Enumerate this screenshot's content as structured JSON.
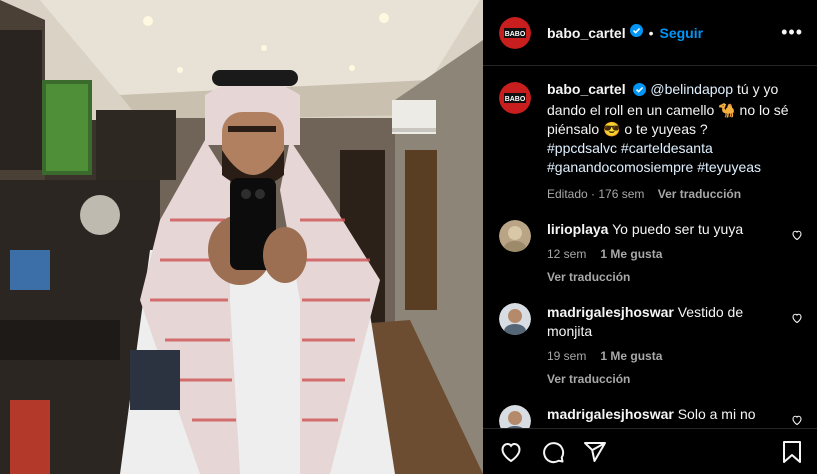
{
  "header": {
    "username": "babo_cartel",
    "separator": "•",
    "follow_label": "Seguir",
    "more_label": "•••"
  },
  "caption": {
    "username": "babo_cartel",
    "mention": "@belindapop",
    "text_1": " tú y yo dando el roll en un camello ",
    "emoji_1": "🐪",
    "text_2": " no lo sé piénsalo ",
    "emoji_2": "😎",
    "text_3": " o te yuyeas ?",
    "hashtags": "#ppcdsalvc #carteldesanta #ganandocomosiempre #teyuyeas",
    "edited": "Editado · 176 sem",
    "translate": "Ver traducción"
  },
  "comments": [
    {
      "username": "lirioplaya",
      "text": "Yo puedo ser tu yuya",
      "time": "12 sem",
      "likes": "1 Me gusta",
      "translate": "Ver traducción"
    },
    {
      "username": "madrigalesjhoswar",
      "text": "Vestido de monjita",
      "time": "19 sem",
      "likes": "1 Me gusta",
      "translate": "Ver traducción"
    },
    {
      "username": "madrigalesjhoswar",
      "text": "Solo a mi no"
    }
  ],
  "icons": {
    "like": "heart-icon",
    "comment": "comment-icon",
    "share": "share-icon",
    "save": "bookmark-icon",
    "verified": "verified-badge-icon"
  },
  "colors": {
    "accent": "#0095f6",
    "verified": "#0095f6",
    "background": "#000000",
    "muted": "#a8a8a8"
  }
}
